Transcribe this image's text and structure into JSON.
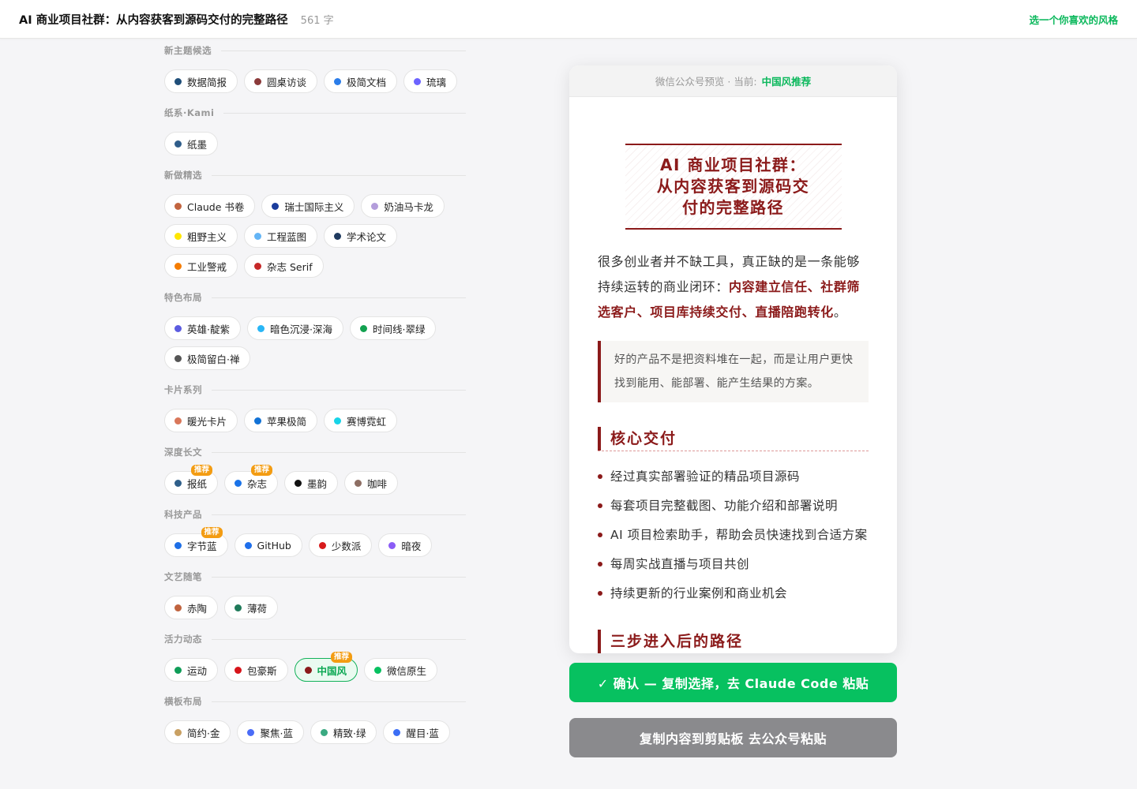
{
  "header": {
    "title": "AI 商业项目社群：从内容获客到源码交付的完整路径",
    "word_count": "561 字",
    "hint": "选一个你喜欢的风格"
  },
  "theme_groups": [
    {
      "title": "新主题候选",
      "items": [
        {
          "label": "数据简报",
          "color": "#1f4e79"
        },
        {
          "label": "圆桌访谈",
          "color": "#8b3a3a"
        },
        {
          "label": "极简文档",
          "color": "#2b7de9"
        },
        {
          "label": "琉璃",
          "color": "#6c63ff"
        }
      ]
    },
    {
      "title": "纸系·Kami",
      "items": [
        {
          "label": "纸墨",
          "color": "#2f5d8a"
        }
      ]
    },
    {
      "title": "新做精选",
      "items": [
        {
          "label": "Claude 书卷",
          "color": "#c2643f"
        },
        {
          "label": "瑞士国际主义",
          "color": "#1a3c9c"
        },
        {
          "label": "奶油马卡龙",
          "color": "#b39ddb"
        },
        {
          "label": "粗野主义",
          "color": "#ffe600"
        },
        {
          "label": "工程蓝图",
          "color": "#64b5f6"
        },
        {
          "label": "学术论文",
          "color": "#1f3a5f"
        },
        {
          "label": "工业警戒",
          "color": "#f57c00"
        },
        {
          "label": "杂志 Serif",
          "color": "#c62828"
        }
      ]
    },
    {
      "title": "特色布局",
      "items": [
        {
          "label": "英雄·靛紫",
          "color": "#5c5ce0"
        },
        {
          "label": "暗色沉浸·深海",
          "color": "#29b6f6"
        },
        {
          "label": "时间线·翠绿",
          "color": "#12a150"
        },
        {
          "label": "极简留白·禅",
          "color": "#555555"
        }
      ]
    },
    {
      "title": "卡片系列",
      "items": [
        {
          "label": "暖光卡片",
          "color": "#d9775a"
        },
        {
          "label": "苹果极简",
          "color": "#1272d6"
        },
        {
          "label": "赛博霓虹",
          "color": "#17d4e8"
        }
      ]
    },
    {
      "title": "深度长文",
      "items": [
        {
          "label": "报纸",
          "color": "#2f5f8a",
          "badge": "推荐"
        },
        {
          "label": "杂志",
          "color": "#1a73e8",
          "badge": "推荐"
        },
        {
          "label": "墨韵",
          "color": "#111111"
        },
        {
          "label": "咖啡",
          "color": "#8d6e63"
        }
      ]
    },
    {
      "title": "科技产品",
      "items": [
        {
          "label": "字节蓝",
          "color": "#1e6fe6",
          "badge": "推荐"
        },
        {
          "label": "GitHub",
          "color": "#1f6feb"
        },
        {
          "label": "少数派",
          "color": "#d71a1b"
        },
        {
          "label": "暗夜",
          "color": "#8b5cf6"
        }
      ]
    },
    {
      "title": "文艺随笔",
      "items": [
        {
          "label": "赤陶",
          "color": "#c0633e"
        },
        {
          "label": "薄荷",
          "color": "#1f7a5a"
        }
      ]
    },
    {
      "title": "活力动态",
      "items": [
        {
          "label": "运动",
          "color": "#0f9d58"
        },
        {
          "label": "包豪斯",
          "color": "#d7141a"
        },
        {
          "label": "中国风",
          "color": "#8b1a1a",
          "badge": "推荐",
          "active": true
        },
        {
          "label": "微信原生",
          "color": "#07c160"
        }
      ]
    },
    {
      "title": "横板布局",
      "items": [
        {
          "label": "简约·金",
          "color": "#c9a063"
        },
        {
          "label": "聚焦·蓝",
          "color": "#4a6cf7"
        },
        {
          "label": "精致·绿",
          "color": "#3aa981"
        },
        {
          "label": "醒目·蓝",
          "color": "#3b6ef5"
        }
      ]
    }
  ],
  "preview": {
    "header_prefix": "微信公众号预览 · 当前:",
    "current": "中国风推荐",
    "title_lines": [
      "AI 商业项目社群：",
      "从内容获客到源码交",
      "付的完整路径"
    ],
    "intro_plain": "很多创业者并不缺工具，真正缺的是一条能够持续运转的商业闭环：",
    "intro_highlight": "内容建立信任、社群筛选客户、项目库持续交付、直播陪跑转化",
    "intro_end": "。",
    "quote": "好的产品不是把资料堆在一起，而是让用户更快找到能用、能部署、能产生结果的方案。",
    "section_title": "核心交付",
    "bullets": [
      "经过真实部署验证的精品项目源码",
      "每套项目完整截图、功能介绍和部署说明",
      "AI 项目检索助手，帮助会员快速找到合适方案",
      "每周实战直播与项目共创",
      "持续更新的行业案例和商业机会"
    ],
    "next_section_title": "三步进入后的路径"
  },
  "actions": {
    "confirm": "✓ 确认 — 复制选择，去 Claude Code 粘贴",
    "copy": "复制内容到剪贴板 去公众号粘贴"
  },
  "colors": {
    "accent_green": "#07c160",
    "theme_red": "#8b1a1a",
    "badge_orange": "#f39c12"
  }
}
